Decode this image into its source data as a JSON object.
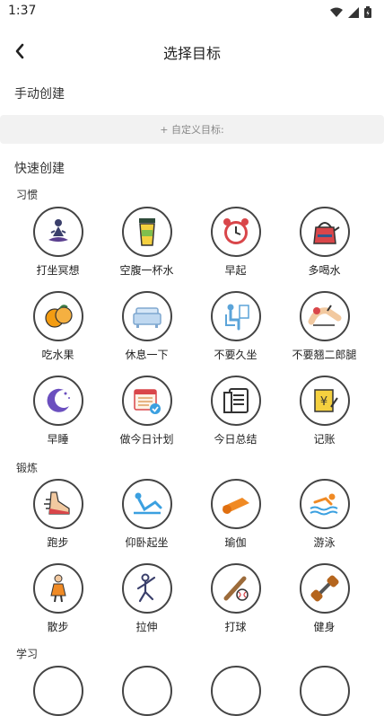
{
  "status_bar": {
    "time": "1:37"
  },
  "header": {
    "title": "选择目标"
  },
  "manual": {
    "title": "手动创建",
    "custom_placeholder": "+ 自定义目标:"
  },
  "quick": {
    "title": "快速创建"
  },
  "categories": [
    {
      "name": "习惯",
      "items": [
        {
          "label": "打坐冥想",
          "icon": "meditation-icon"
        },
        {
          "label": "空腹一杯水",
          "icon": "water-cup-icon"
        },
        {
          "label": "早起",
          "icon": "alarm-clock-icon"
        },
        {
          "label": "多喝水",
          "icon": "kettle-icon"
        },
        {
          "label": "吃水果",
          "icon": "fruit-icon"
        },
        {
          "label": "休息一下",
          "icon": "sofa-icon"
        },
        {
          "label": "不要久坐",
          "icon": "sitting-person-icon"
        },
        {
          "label": "不要翘二郎腿",
          "icon": "crossed-legs-icon"
        },
        {
          "label": "早睡",
          "icon": "moon-icon"
        },
        {
          "label": "做今日计划",
          "icon": "calendar-check-icon"
        },
        {
          "label": "今日总结",
          "icon": "document-summary-icon"
        },
        {
          "label": "记账",
          "icon": "ledger-yen-icon"
        }
      ]
    },
    {
      "name": "锻炼",
      "items": [
        {
          "label": "跑步",
          "icon": "running-shoe-icon"
        },
        {
          "label": "仰卧起坐",
          "icon": "sit-up-icon"
        },
        {
          "label": "瑜伽",
          "icon": "yoga-mat-icon"
        },
        {
          "label": "游泳",
          "icon": "swimmer-icon"
        },
        {
          "label": "散步",
          "icon": "walking-girl-icon"
        },
        {
          "label": "拉伸",
          "icon": "stretch-icon"
        },
        {
          "label": "打球",
          "icon": "baseball-icon"
        },
        {
          "label": "健身",
          "icon": "dumbbell-icon"
        }
      ]
    },
    {
      "name": "学习",
      "items": []
    }
  ],
  "colors": {
    "border": "#444444",
    "accent_orange": "#F08A24",
    "accent_blue": "#3BA0E0",
    "accent_red": "#D9464A",
    "accent_purple": "#6B4FBF"
  }
}
